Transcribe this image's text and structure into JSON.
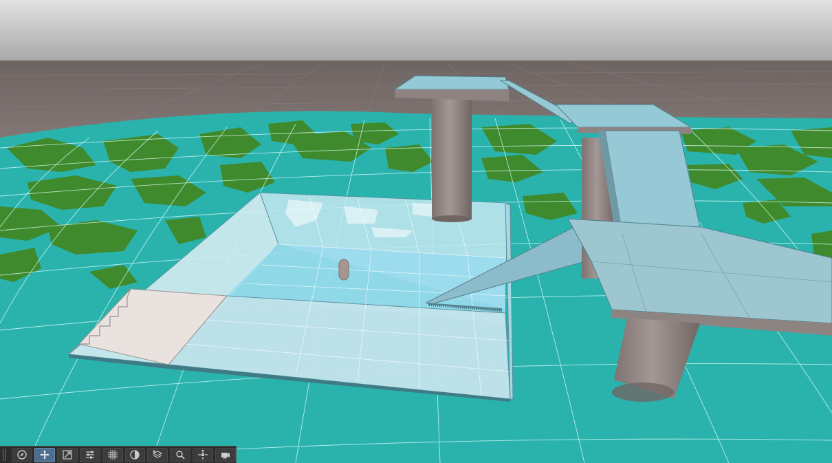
{
  "colors": {
    "sky_top": "#dcdcdc",
    "sky_horizon": "#a9a9a9",
    "ground_far": "#7a6f6d",
    "terrain_water": "#2ab3ad",
    "terrain_grass": "#3e8a2c",
    "wireframe": "#e6ffff",
    "pool_glass": "#bfe8f2",
    "pool_water": "#9adcee",
    "pillar": "#8f8583",
    "platform": "#8fc6d4",
    "toolbar_bg": "#2b2b2b",
    "toolbar_active": "#4b6d8e"
  },
  "toolbar": {
    "tools": [
      {
        "name": "navigate-tool",
        "icon": "compass-icon",
        "active": false
      },
      {
        "name": "move-tool",
        "icon": "move-arrows-icon",
        "active": true
      },
      {
        "name": "scale-tool",
        "icon": "scale-icon",
        "active": false
      },
      {
        "name": "adjust-tool",
        "icon": "sliders-icon",
        "active": false
      },
      {
        "name": "grid-tool",
        "icon": "grid-icon",
        "active": false
      },
      {
        "name": "shading-tool",
        "icon": "half-circle-icon",
        "active": false
      },
      {
        "name": "layers-tool",
        "icon": "layers-icon",
        "active": false
      },
      {
        "name": "zoom-tool",
        "icon": "magnifier-icon",
        "active": false
      },
      {
        "name": "pivot-tool",
        "icon": "pivot-icon",
        "active": false
      },
      {
        "name": "camera-tool",
        "icon": "camera-icon",
        "active": false
      }
    ]
  }
}
